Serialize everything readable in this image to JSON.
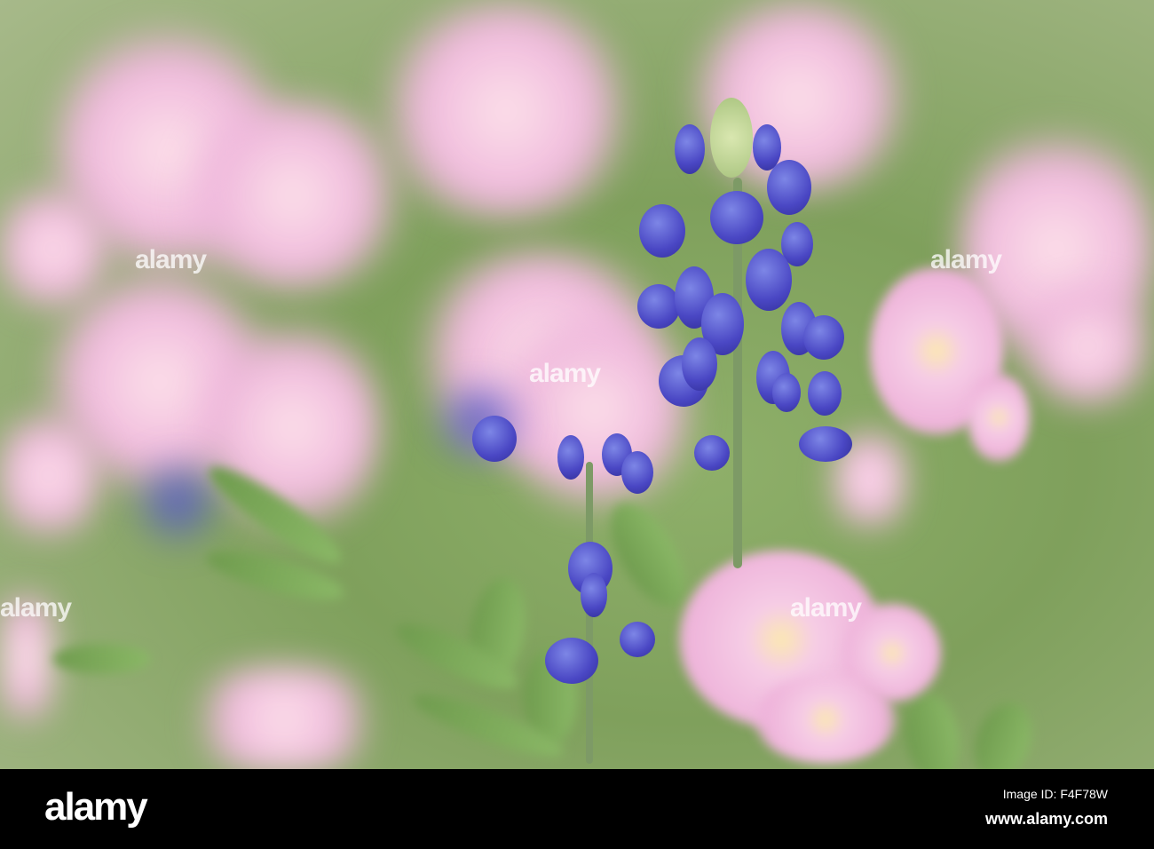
{
  "watermark": {
    "text": "alamy"
  },
  "footer": {
    "logo": "alamy",
    "image_id": "Image ID: F4F78W",
    "website": "www.alamy.com"
  },
  "colors": {
    "pink": "#efb8dc",
    "bluebonnet": "#4a47c4",
    "foliage": "#7fa05c"
  }
}
